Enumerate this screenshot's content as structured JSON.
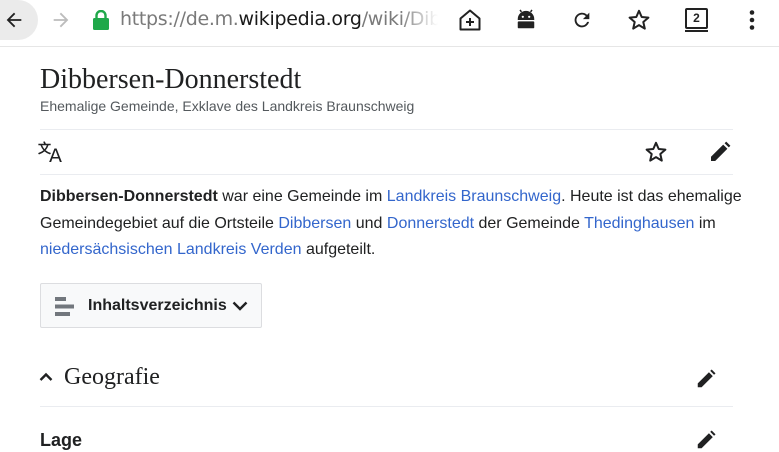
{
  "browser": {
    "url_prefix": "https://de.m.",
    "url_host": "wikipedia.org",
    "url_path": "/wiki/Dibbersen",
    "tab_count": "2"
  },
  "article": {
    "title": "Dibbersen-Donnerstedt",
    "subtitle": "Ehemalige Gemeinde, Exklave des Landkreis Braunschweig",
    "intro": {
      "bold": "Dibbersen-Donnerstedt",
      "t1": " war eine Gemeinde im ",
      "link1": "Landkreis Braunschweig",
      "t2": ". Heute ist das ehemalige",
      "t3": "Gemeindegebiet auf die Ortsteile ",
      "link2": "Dibbersen",
      "t4": " und ",
      "link3": "Donnerstedt",
      "t5": " der Gemeinde ",
      "link4": "Thedinghausen",
      "t6": " im",
      "link5": "niedersächsischen Landkreis Verden",
      "t7": " aufgeteilt."
    },
    "toc_label": "Inhaltsverzeichnis",
    "section_title": "Geografie",
    "subsection_title": "Lage"
  },
  "colors": {
    "link": "#3366cc",
    "secure_lock": "#1fa84a"
  }
}
